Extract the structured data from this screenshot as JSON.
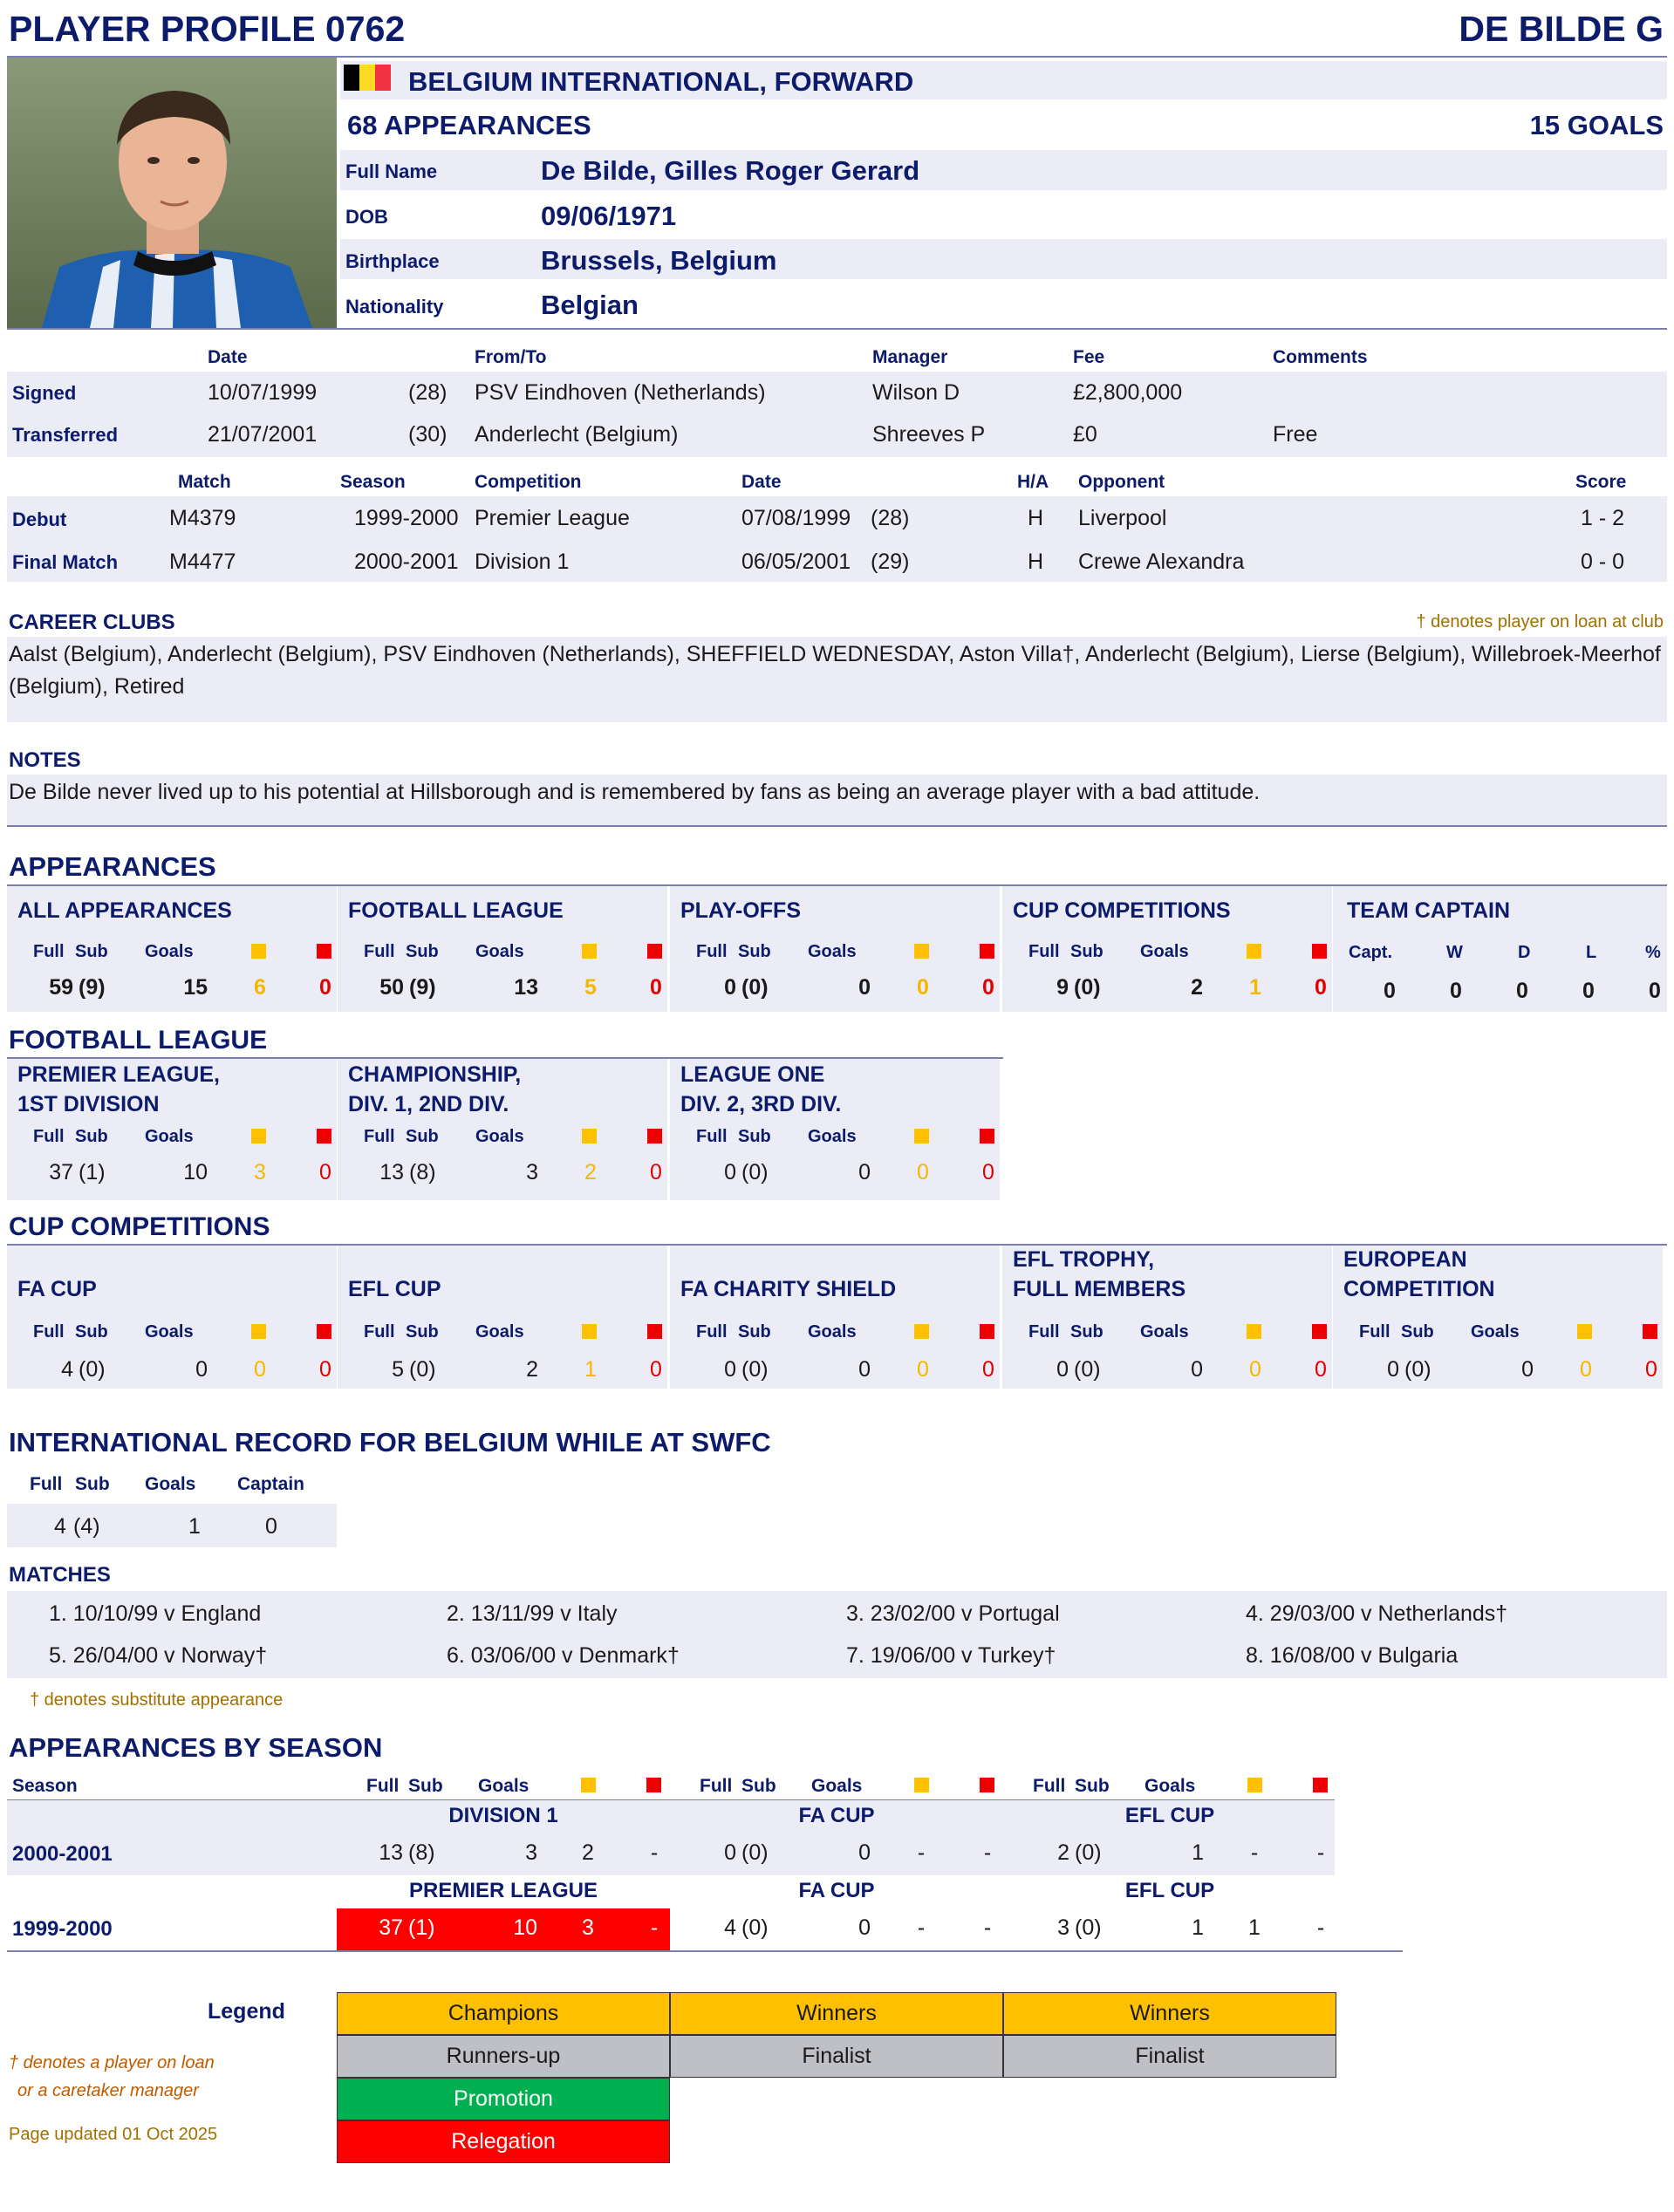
{
  "header": {
    "profile_title": "PLAYER PROFILE 0762",
    "player_short": "DE BILDE G"
  },
  "bio": {
    "role_line": "BELGIUM INTERNATIONAL, FORWARD",
    "appearances_line": "68 APPEARANCES",
    "goals_line": "15 GOALS",
    "flag_colors": [
      "#000000",
      "#FDDA24",
      "#EF3340"
    ],
    "fields": [
      {
        "label": "Full Name",
        "value": "De Bilde, Gilles Roger Gerard"
      },
      {
        "label": "DOB",
        "value": "09/06/1971"
      },
      {
        "label": "Birthplace",
        "value": "Brussels, Belgium"
      },
      {
        "label": "Nationality",
        "value": "Belgian"
      }
    ]
  },
  "transfers": {
    "headers": {
      "date": "Date",
      "from_to": "From/To",
      "manager": "Manager",
      "fee": "Fee",
      "comments": "Comments"
    },
    "rows": [
      {
        "type": "Signed",
        "date": "10/07/1999",
        "age": "(28)",
        "club": "PSV Eindhoven (Netherlands)",
        "manager": "Wilson D",
        "fee": "£2,800,000",
        "comments": ""
      },
      {
        "type": "Transferred",
        "date": "21/07/2001",
        "age": "(30)",
        "club": "Anderlecht (Belgium)",
        "manager": "Shreeves P",
        "fee": "£0",
        "comments": "Free"
      }
    ]
  },
  "matches": {
    "headers": {
      "match": "Match",
      "season": "Season",
      "competition": "Competition",
      "date": "Date",
      "ha": "H/A",
      "opponent": "Opponent",
      "score": "Score"
    },
    "rows": [
      {
        "type": "Debut",
        "match": "M4379",
        "season": "1999-2000",
        "competition": "Premier League",
        "date": "07/08/1999",
        "age": "(28)",
        "ha": "H",
        "opponent": "Liverpool",
        "score": "1 - 2"
      },
      {
        "type": "Final Match",
        "match": "M4477",
        "season": "2000-2001",
        "competition": "Division 1",
        "date": "06/05/2001",
        "age": "(29)",
        "ha": "H",
        "opponent": "Crewe Alexandra",
        "score": "0 - 0"
      }
    ]
  },
  "career": {
    "title": "CAREER CLUBS",
    "loan_note": "† denotes player on loan at club",
    "line1": "Aalst (Belgium), Anderlecht (Belgium), PSV Eindhoven (Netherlands), SHEFFIELD WEDNESDAY, Aston Villa†, Anderlecht (Belgium), Lierse (Belgium), Willebroek-Meerhof",
    "line2": "(Belgium), Retired"
  },
  "notes": {
    "title": "NOTES",
    "text": "De Bilde never lived up to his potential at Hillsborough and is remembered by fans as being an average player with a bad attitude."
  },
  "appearances": {
    "title": "APPEARANCES",
    "col_full": "Full",
    "col_sub": "Sub",
    "col_goals": "Goals",
    "blocks": [
      {
        "title": "ALL APPEARANCES",
        "full": "59",
        "sub": "(9)",
        "goals": "15",
        "yellow": "6",
        "red": "0"
      },
      {
        "title": "FOOTBALL LEAGUE",
        "full": "50",
        "sub": "(9)",
        "goals": "13",
        "yellow": "5",
        "red": "0"
      },
      {
        "title": "PLAY-OFFS",
        "full": "0",
        "sub": "(0)",
        "goals": "0",
        "yellow": "0",
        "red": "0"
      },
      {
        "title": "CUP COMPETITIONS",
        "full": "9",
        "sub": "(0)",
        "goals": "2",
        "yellow": "1",
        "red": "0"
      }
    ],
    "captain": {
      "title": "TEAM CAPTAIN",
      "headers": [
        "Capt.",
        "W",
        "D",
        "L",
        "%"
      ],
      "values": [
        "0",
        "0",
        "0",
        "0",
        "0"
      ]
    }
  },
  "football_league": {
    "title": "FOOTBALL LEAGUE",
    "blocks": [
      {
        "title1": "PREMIER LEAGUE,",
        "title2": "1ST DIVISION",
        "full": "37",
        "sub": "(1)",
        "goals": "10",
        "yellow": "3",
        "red": "0"
      },
      {
        "title1": "CHAMPIONSHIP,",
        "title2": "DIV. 1, 2ND DIV.",
        "full": "13",
        "sub": "(8)",
        "goals": "3",
        "yellow": "2",
        "red": "0"
      },
      {
        "title1": "LEAGUE ONE",
        "title2": "DIV. 2, 3RD DIV.",
        "full": "0",
        "sub": "(0)",
        "goals": "0",
        "yellow": "0",
        "red": "0"
      }
    ]
  },
  "cup_competitions": {
    "title": "CUP COMPETITIONS",
    "blocks": [
      {
        "title1": "",
        "title2": "FA CUP",
        "full": "4",
        "sub": "(0)",
        "goals": "0",
        "yellow": "0",
        "red": "0"
      },
      {
        "title1": "",
        "title2": "EFL CUP",
        "full": "5",
        "sub": "(0)",
        "goals": "2",
        "yellow": "1",
        "red": "0"
      },
      {
        "title1": "",
        "title2": "FA CHARITY SHIELD",
        "full": "0",
        "sub": "(0)",
        "goals": "0",
        "yellow": "0",
        "red": "0"
      },
      {
        "title1": "EFL TROPHY,",
        "title2": "FULL MEMBERS",
        "full": "0",
        "sub": "(0)",
        "goals": "0",
        "yellow": "0",
        "red": "0"
      },
      {
        "title1": "EUROPEAN",
        "title2": "COMPETITION",
        "full": "0",
        "sub": "(0)",
        "goals": "0",
        "yellow": "0",
        "red": "0"
      }
    ]
  },
  "international": {
    "title": "INTERNATIONAL RECORD FOR BELGIUM WHILE AT SWFC",
    "headers": {
      "full": "Full",
      "sub": "Sub",
      "goals": "Goals",
      "captain": "Captain"
    },
    "full": "4",
    "sub": "(4)",
    "goals": "1",
    "captain": "0",
    "matches_title": "MATCHES",
    "matches": [
      "1. 10/10/99 v England",
      "2. 13/11/99 v Italy",
      "3. 23/02/00 v Portugal",
      "4. 29/03/00 v Netherlands†",
      "5. 26/04/00 v Norway†",
      "6. 03/06/00 v Denmark†",
      "7. 19/06/00 v Turkey†",
      "8. 16/08/00 v Bulgaria"
    ],
    "sub_note": "† denotes substitute appearance"
  },
  "by_season": {
    "title": "APPEARANCES BY SEASON",
    "season_label": "Season",
    "rows": [
      {
        "season": "2000-2001",
        "league": "DIVISION 1",
        "cup1": "FA CUP",
        "cup2": "EFL CUP",
        "l": {
          "full": "13",
          "sub": "(8)",
          "goals": "3",
          "y": "2",
          "r": "-"
        },
        "c1": {
          "full": "0",
          "sub": "(0)",
          "goals": "0",
          "y": "-",
          "r": "-"
        },
        "c2": {
          "full": "2",
          "sub": "(0)",
          "goals": "1",
          "y": "-",
          "r": "-"
        }
      },
      {
        "season": "1999-2000",
        "league": "PREMIER LEAGUE",
        "cup1": "FA CUP",
        "cup2": "EFL CUP",
        "l": {
          "full": "37",
          "sub": "(1)",
          "goals": "10",
          "y": "3",
          "r": "-"
        },
        "c1": {
          "full": "4",
          "sub": "(0)",
          "goals": "0",
          "y": "-",
          "r": "-"
        },
        "c2": {
          "full": "3",
          "sub": "(0)",
          "goals": "1",
          "y": "1",
          "r": "-"
        }
      }
    ]
  },
  "legend": {
    "title": "Legend",
    "loan_note1": "† denotes a player on loan",
    "loan_note2": "or a caretaker manager",
    "updated": "Page updated 01 Oct 2025",
    "champions": "Champions",
    "winners1": "Winners",
    "winners2": "Winners",
    "runners_up": "Runners-up",
    "finalist1": "Finalist",
    "finalist2": "Finalist",
    "promotion": "Promotion",
    "relegation": "Relegation",
    "colors": {
      "gold": "#FFC000",
      "grey": "#BFBFC6",
      "green": "#00B050",
      "red": "#FF0000"
    }
  }
}
